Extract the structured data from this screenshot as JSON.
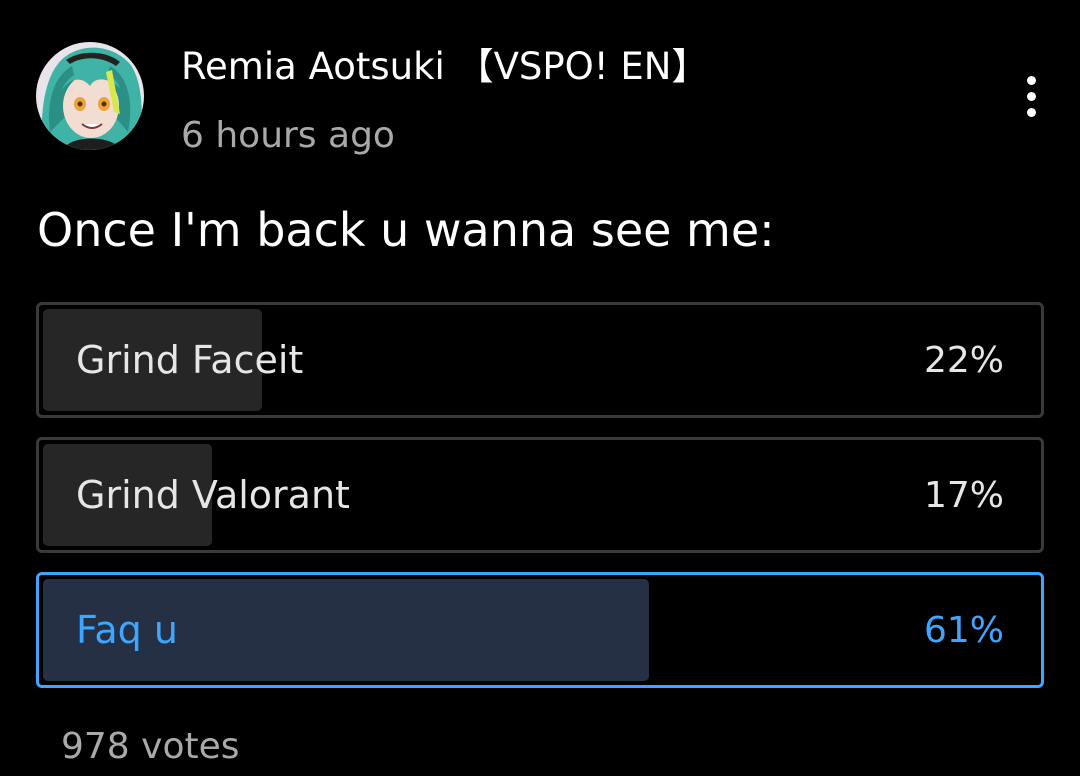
{
  "post": {
    "author": "Remia Aotsuki 【VSPO! EN】",
    "timestamp": "6 hours ago",
    "menu_icon": "more-vert-icon",
    "avatar_icon": "avatar"
  },
  "poll": {
    "question": "Once I'm back u wanna see me:",
    "options": [
      {
        "label": "Grind Faceit",
        "percent_label": "22%",
        "percent": 22,
        "selected": false
      },
      {
        "label": "Grind Valorant",
        "percent_label": "17%",
        "percent": 17,
        "selected": false
      },
      {
        "label": "Faq u",
        "percent_label": "61%",
        "percent": 61,
        "selected": true
      }
    ],
    "votes": "978 votes"
  },
  "colors": {
    "background": "#000000",
    "accent": "#3ea6ff",
    "secondary_text": "#a9a9a9",
    "option_fill": "#262626",
    "selected_fill": "#263044",
    "option_border": "#3a3a3a"
  }
}
